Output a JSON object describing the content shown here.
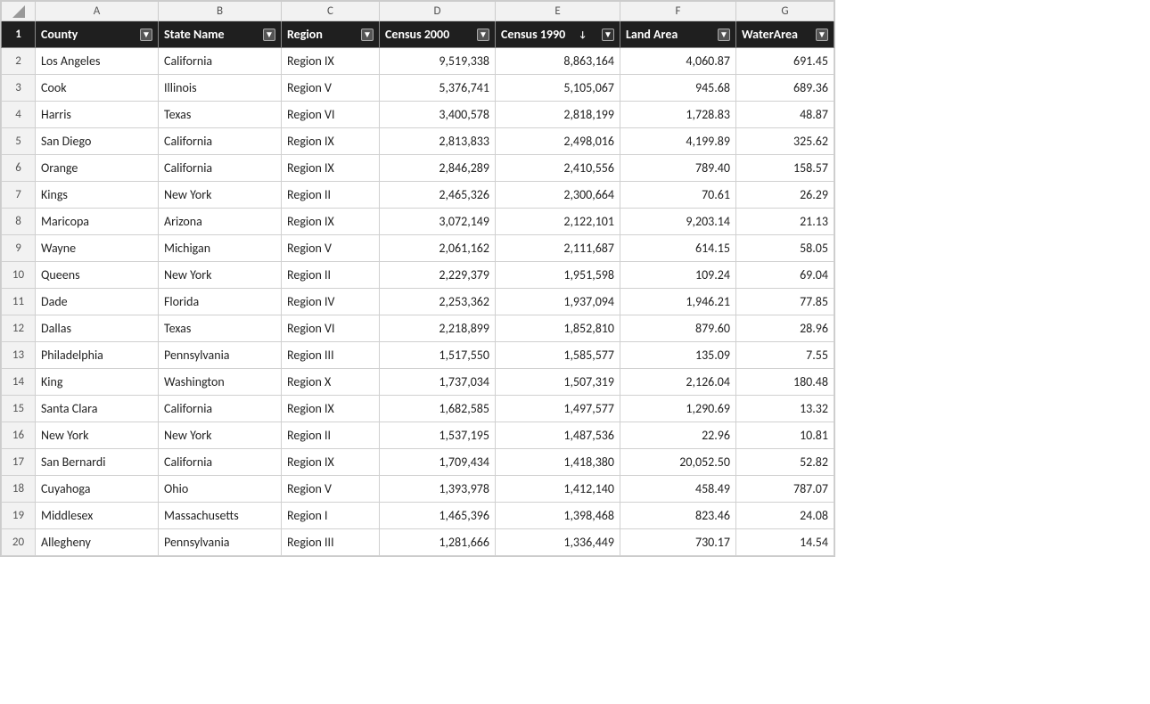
{
  "columns": {
    "row_header": "",
    "A": "A",
    "B": "B",
    "C": "C",
    "D": "D",
    "E": "E",
    "F": "F",
    "G": "G"
  },
  "headers": {
    "county": "County",
    "state": "State Name",
    "region": "Region",
    "census2000": "Census 2000",
    "census1990": "Census 1990",
    "landarea": "Land Area",
    "waterarea": "WaterArea"
  },
  "rows": [
    {
      "num": 2,
      "county": "Los Angeles",
      "state": "California",
      "region": "Region IX",
      "census2000": "9,519,338",
      "census1990": "8,863,164",
      "landarea": "4,060.87",
      "waterarea": "691.45"
    },
    {
      "num": 3,
      "county": "Cook",
      "state": "Illinois",
      "region": "Region V",
      "census2000": "5,376,741",
      "census1990": "5,105,067",
      "landarea": "945.68",
      "waterarea": "689.36"
    },
    {
      "num": 4,
      "county": "Harris",
      "state": "Texas",
      "region": "Region VI",
      "census2000": "3,400,578",
      "census1990": "2,818,199",
      "landarea": "1,728.83",
      "waterarea": "48.87"
    },
    {
      "num": 5,
      "county": "San Diego",
      "state": "California",
      "region": "Region IX",
      "census2000": "2,813,833",
      "census1990": "2,498,016",
      "landarea": "4,199.89",
      "waterarea": "325.62"
    },
    {
      "num": 6,
      "county": "Orange",
      "state": "California",
      "region": "Region IX",
      "census2000": "2,846,289",
      "census1990": "2,410,556",
      "landarea": "789.40",
      "waterarea": "158.57"
    },
    {
      "num": 7,
      "county": "Kings",
      "state": "New York",
      "region": "Region II",
      "census2000": "2,465,326",
      "census1990": "2,300,664",
      "landarea": "70.61",
      "waterarea": "26.29"
    },
    {
      "num": 8,
      "county": "Maricopa",
      "state": "Arizona",
      "region": "Region IX",
      "census2000": "3,072,149",
      "census1990": "2,122,101",
      "landarea": "9,203.14",
      "waterarea": "21.13"
    },
    {
      "num": 9,
      "county": "Wayne",
      "state": "Michigan",
      "region": "Region V",
      "census2000": "2,061,162",
      "census1990": "2,111,687",
      "landarea": "614.15",
      "waterarea": "58.05"
    },
    {
      "num": 10,
      "county": "Queens",
      "state": "New York",
      "region": "Region II",
      "census2000": "2,229,379",
      "census1990": "1,951,598",
      "landarea": "109.24",
      "waterarea": "69.04"
    },
    {
      "num": 11,
      "county": "Dade",
      "state": "Florida",
      "region": "Region IV",
      "census2000": "2,253,362",
      "census1990": "1,937,094",
      "landarea": "1,946.21",
      "waterarea": "77.85"
    },
    {
      "num": 12,
      "county": "Dallas",
      "state": "Texas",
      "region": "Region VI",
      "census2000": "2,218,899",
      "census1990": "1,852,810",
      "landarea": "879.60",
      "waterarea": "28.96"
    },
    {
      "num": 13,
      "county": "Philadelphia",
      "state": "Pennsylvania",
      "region": "Region III",
      "census2000": "1,517,550",
      "census1990": "1,585,577",
      "landarea": "135.09",
      "waterarea": "7.55"
    },
    {
      "num": 14,
      "county": "King",
      "state": "Washington",
      "region": "Region X",
      "census2000": "1,737,034",
      "census1990": "1,507,319",
      "landarea": "2,126.04",
      "waterarea": "180.48"
    },
    {
      "num": 15,
      "county": "Santa Clara",
      "state": "California",
      "region": "Region IX",
      "census2000": "1,682,585",
      "census1990": "1,497,577",
      "landarea": "1,290.69",
      "waterarea": "13.32"
    },
    {
      "num": 16,
      "county": "New York",
      "state": "New York",
      "region": "Region II",
      "census2000": "1,537,195",
      "census1990": "1,487,536",
      "landarea": "22.96",
      "waterarea": "10.81"
    },
    {
      "num": 17,
      "county": "San Bernardi",
      "state": "California",
      "region": "Region IX",
      "census2000": "1,709,434",
      "census1990": "1,418,380",
      "landarea": "20,052.50",
      "waterarea": "52.82"
    },
    {
      "num": 18,
      "county": "Cuyahoga",
      "state": "Ohio",
      "region": "Region V",
      "census2000": "1,393,978",
      "census1990": "1,412,140",
      "landarea": "458.49",
      "waterarea": "787.07"
    },
    {
      "num": 19,
      "county": "Middlesex",
      "state": "Massachusetts",
      "region": "Region I",
      "census2000": "1,465,396",
      "census1990": "1,398,468",
      "landarea": "823.46",
      "waterarea": "24.08"
    },
    {
      "num": 20,
      "county": "Allegheny",
      "state": "Pennsylvania",
      "region": "Region III",
      "census2000": "1,281,666",
      "census1990": "1,336,449",
      "landarea": "730.17",
      "waterarea": "14.54"
    }
  ]
}
